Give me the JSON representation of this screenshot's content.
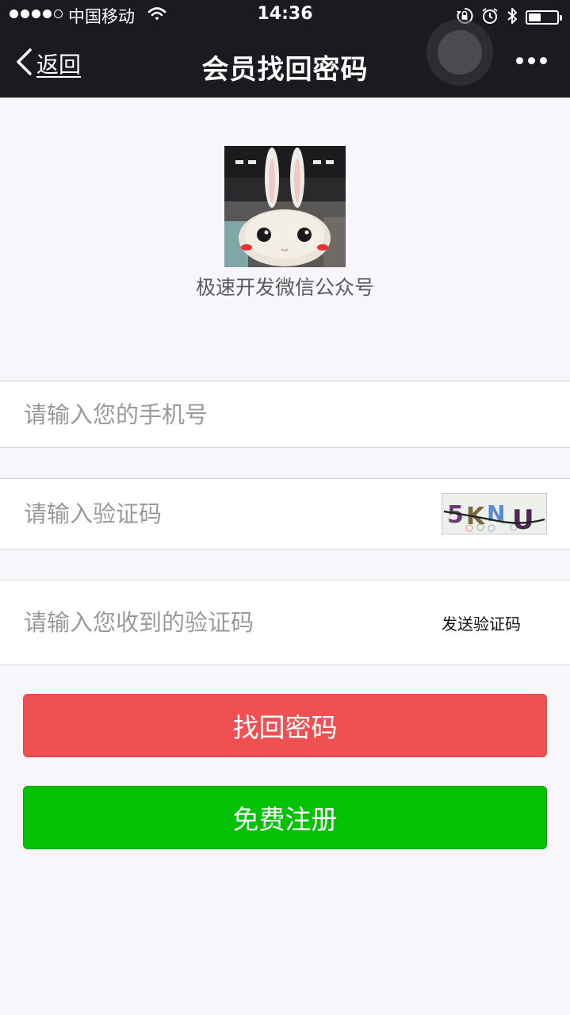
{
  "status_bar": {
    "carrier": "中国移动",
    "time": "14:36",
    "battery_level": 0.45
  },
  "nav": {
    "back_label": "返回",
    "title": "会员找回密码"
  },
  "brand": {
    "name": "极速开发微信公众号"
  },
  "form": {
    "phone_placeholder": "请输入您的手机号",
    "captcha_placeholder": "请输入验证码",
    "captcha_text": "5KNU",
    "sms_placeholder": "请输入您收到的验证码",
    "send_code_label": "发送验证码"
  },
  "buttons": {
    "recover_label": "找回密码",
    "register_label": "免费注册"
  },
  "colors": {
    "recover_button": "#ef5052",
    "register_button": "#03c103",
    "topbar": "#1b1a20"
  }
}
